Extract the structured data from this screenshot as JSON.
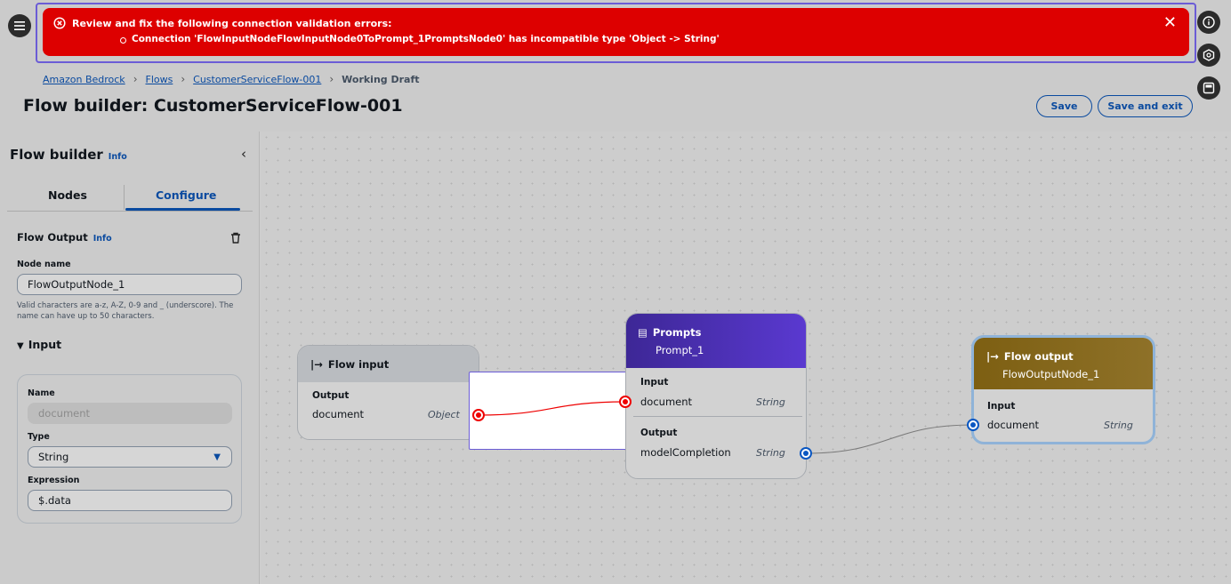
{
  "flash": {
    "title": "Review and fix the following connection validation errors:",
    "detail": "Connection 'FlowInputNodeFlowInputNode0ToPrompt_1PromptsNode0' has incompatible type 'Object -> String'",
    "close_icon": "close-icon",
    "color": "#dd0000"
  },
  "breadcrumb": {
    "items": [
      "Amazon Bedrock",
      "Flows",
      "CustomerServiceFlow-001"
    ],
    "current": "Working Draft"
  },
  "header": {
    "title": "Flow builder: CustomerServiceFlow-001",
    "save_label": "Save",
    "save_exit_label": "Save and exit"
  },
  "panel": {
    "title": "Flow builder",
    "info": "Info",
    "tabs": [
      "Nodes",
      "Configure"
    ],
    "active_tab": "Configure",
    "section_title": "Flow Output",
    "section_info": "Info",
    "node_name_label": "Node name",
    "node_name_value": "FlowOutputNode_1",
    "node_name_hint": "Valid characters are a-z, A-Z, 0-9 and _ (underscore). The name can have up to 50 characters.",
    "input_section": "Input",
    "input": {
      "name_label": "Name",
      "name_value": "document",
      "type_label": "Type",
      "type_value": "String",
      "expression_label": "Expression",
      "expression_value": "$.data"
    }
  },
  "nodes": {
    "flow_input": {
      "title": "Flow input",
      "output_label": "Output",
      "field": "document",
      "type": "Object"
    },
    "prompts": {
      "title": "Prompts",
      "subtitle": "Prompt_1",
      "input_label": "Input",
      "input_field": "document",
      "input_type": "String",
      "output_label": "Output",
      "output_field": "modelCompletion",
      "output_type": "String",
      "color": "#4b2fb8"
    },
    "flow_output": {
      "title": "Flow output",
      "subtitle": "FlowOutputNode_1",
      "input_label": "Input",
      "field": "document",
      "type": "String",
      "color": "#8a6a16"
    }
  }
}
